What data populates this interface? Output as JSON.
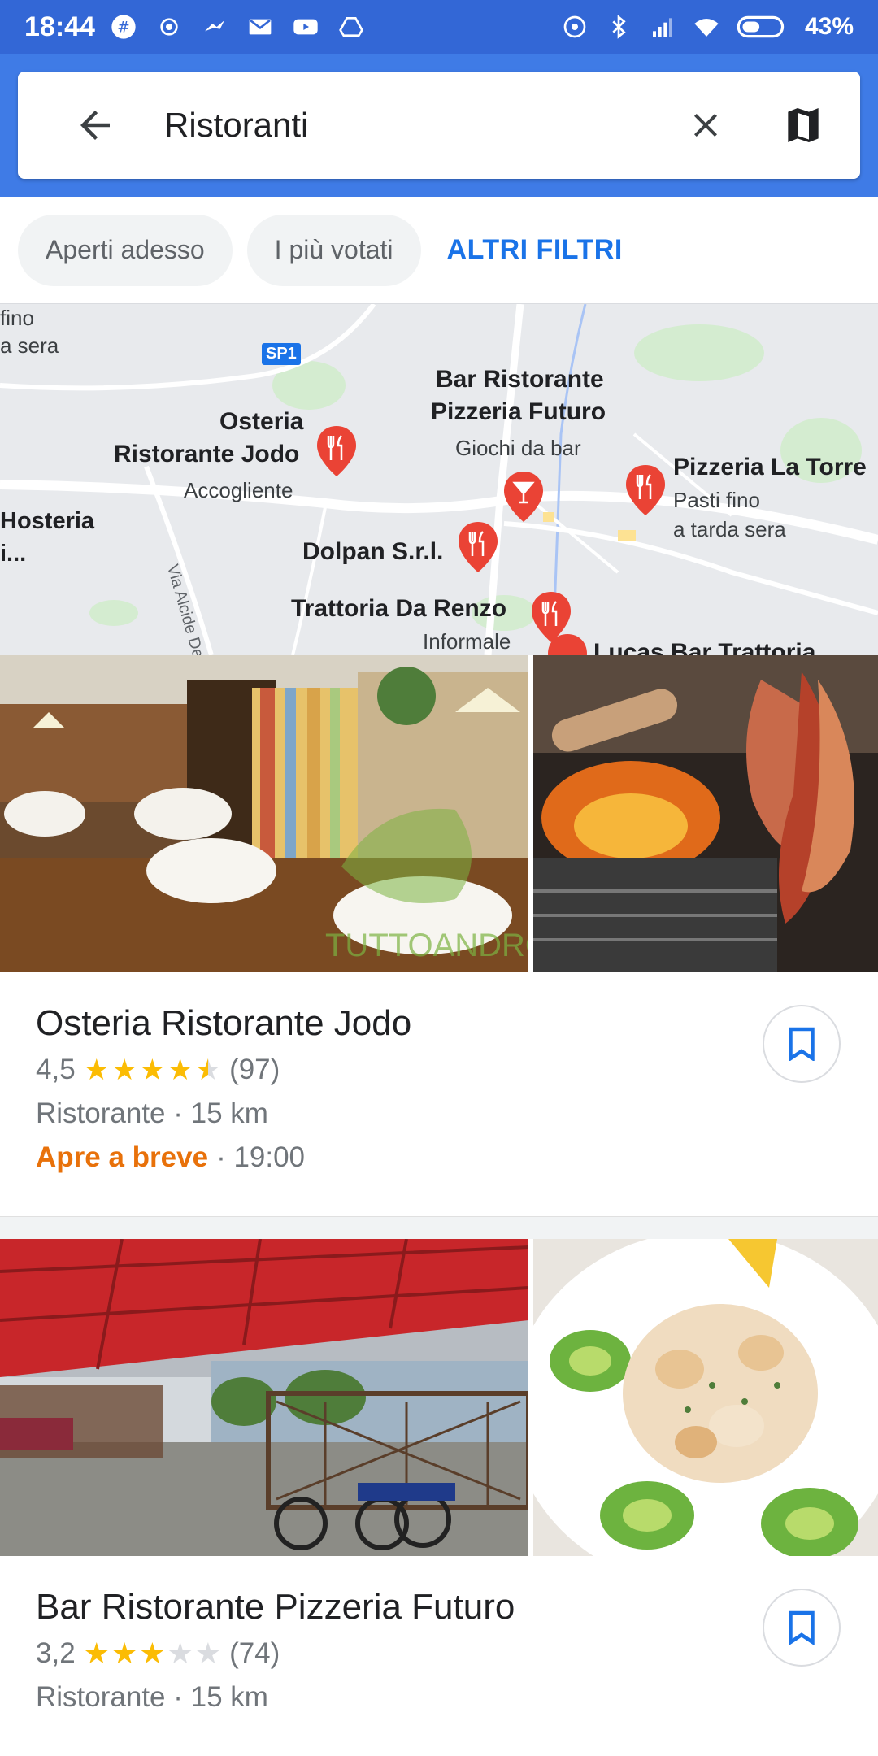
{
  "status_bar": {
    "time": "18:44",
    "battery": "43%"
  },
  "search": {
    "query": "Ristoranti"
  },
  "filters": {
    "chips": [
      "Aperti adesso",
      "I più votati"
    ],
    "more_filters": "ALTRI FILTRI"
  },
  "map": {
    "road_badge": "SP1",
    "road_name": "Via Alcide De",
    "edge_labels": {
      "top_left_1": "fino",
      "top_left_2": "a sera",
      "left_1": "Hosteria",
      "left_2": "i..."
    },
    "places": [
      {
        "name_1": "Osteria",
        "name_2": "Ristorante Jodo",
        "sub": "Accogliente"
      },
      {
        "name_1": "Bar Ristorante",
        "name_2": "Pizzeria Futuro",
        "sub": "Giochi da bar"
      },
      {
        "name_1": "Pizzeria La Torre",
        "sub_1": "Pasti fino",
        "sub_2": "a tarda sera"
      },
      {
        "name_1": "Dolpan S.r.l."
      },
      {
        "name_1": "Trattoria Da Renzo",
        "sub": "Informale"
      },
      {
        "name_1": "Lucas Bar Trattoria"
      }
    ]
  },
  "results": [
    {
      "name": "Osteria Ristorante Jodo",
      "rating": "4,5",
      "rating_value": 4.5,
      "reviews": "(97)",
      "category": "Ristorante · 15 km",
      "opening": "Apre a breve",
      "opening_time": "· 19:00",
      "watermark": "TUTTOANDROID"
    },
    {
      "name": "Bar Ristorante Pizzeria Futuro",
      "rating": "3,2",
      "rating_value": 3.2,
      "reviews": "(74)",
      "category": "Ristorante · 15 km"
    }
  ],
  "colors": {
    "header_blue": "#3f7be6",
    "status_blue": "#3367d6",
    "accent_blue": "#1a73e8",
    "star": "#fbbc04",
    "opening_orange": "#e8710a",
    "pin_red": "#ea4335"
  }
}
